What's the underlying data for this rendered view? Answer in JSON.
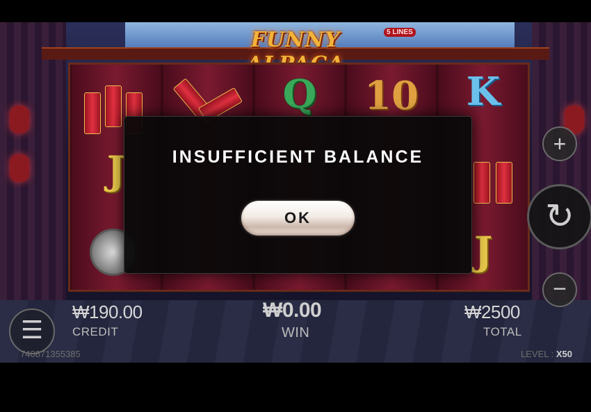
{
  "game": {
    "title": "FUNNY ALPACA",
    "lines_badge": "5 LINES"
  },
  "reels": {
    "symbols": {
      "q": "Q",
      "ten": "10",
      "k": "K",
      "j1": "J",
      "j2": "J"
    }
  },
  "controls": {
    "plus_icon": "+",
    "minus_icon": "−",
    "spin_icon": "↻",
    "menu_icon": "☰"
  },
  "info": {
    "credit_value": "₩190.00",
    "credit_label": "CREDIT",
    "win_value": "₩0.00",
    "win_label": "WIN",
    "total_value": "₩2500",
    "total_label": "TOTAL",
    "session_id": "740871355385",
    "level_label": "LEVEL : ",
    "level_value": "X50"
  },
  "modal": {
    "message": "INSUFFICIENT BALANCE",
    "ok_label": "OK"
  },
  "colors": {
    "accent": "#f2b33a",
    "modal_bg": "#080808"
  }
}
